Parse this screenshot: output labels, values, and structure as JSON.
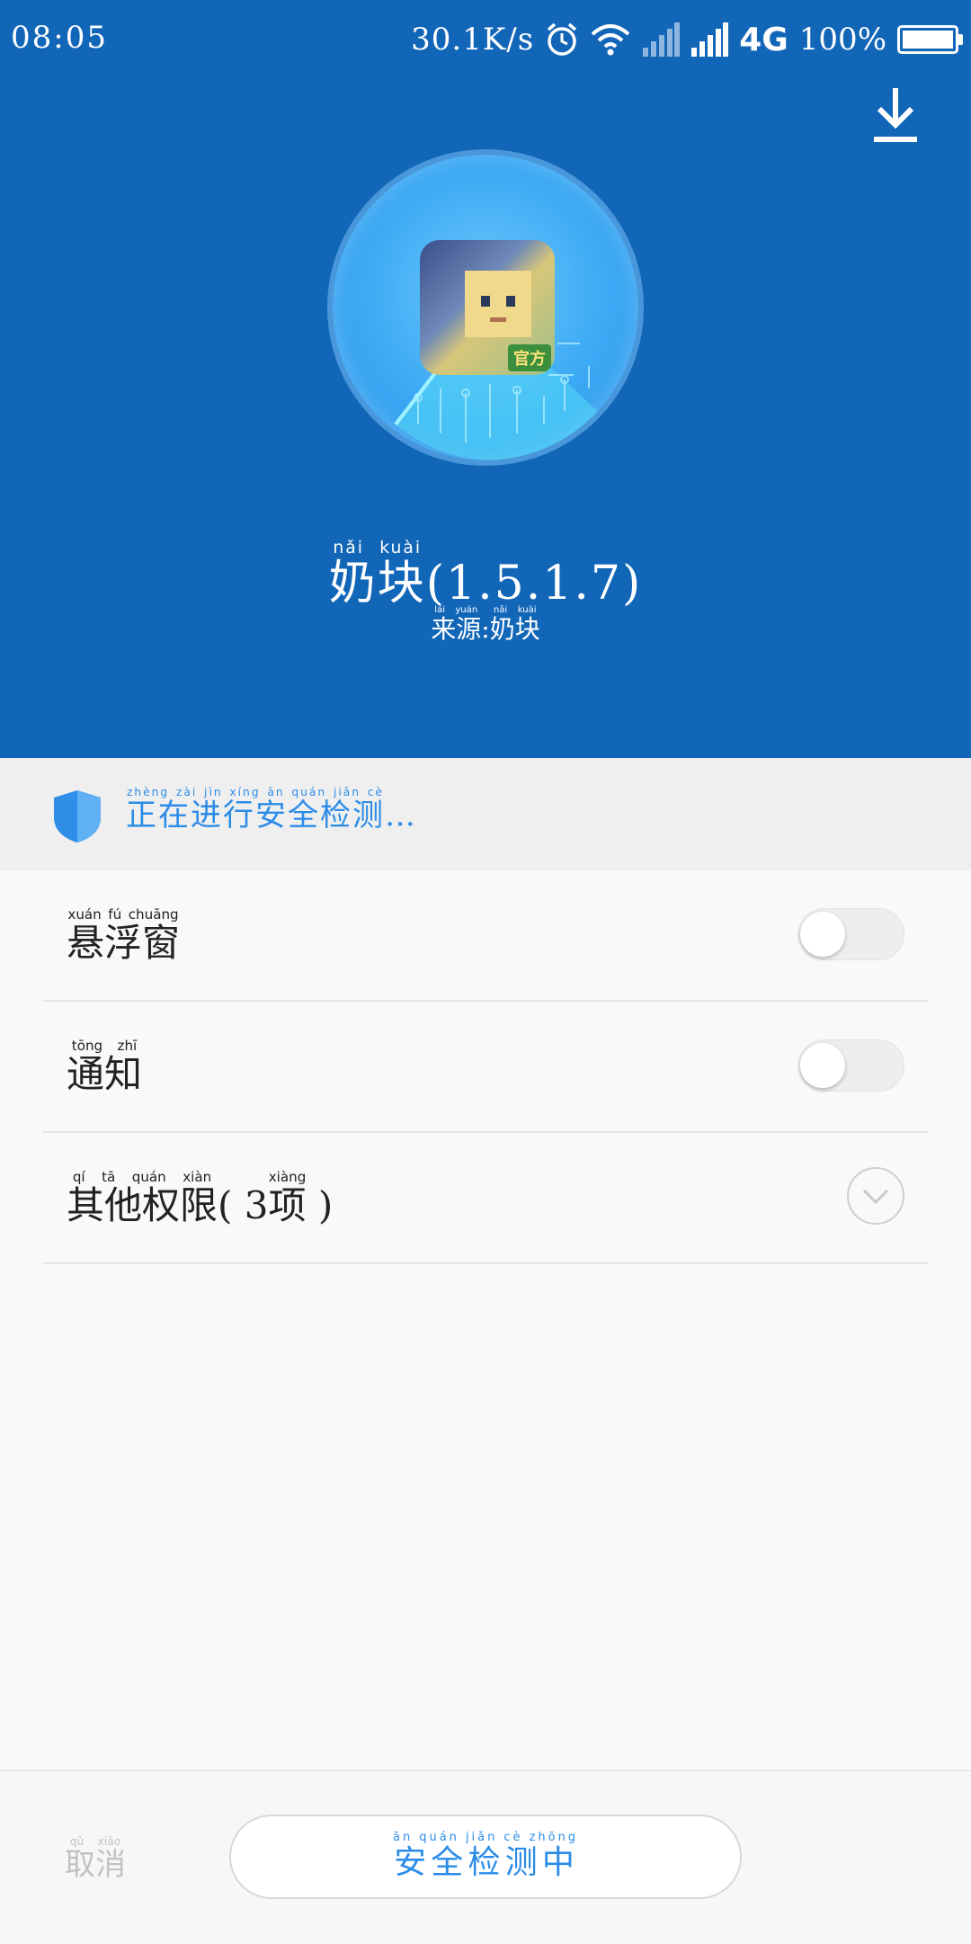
{
  "status_bar": {
    "time": "08:05",
    "net_speed": "30.1K/s",
    "network_type": "4G",
    "battery": "100%",
    "battery_level": 1.0,
    "icons": [
      "alarm-icon",
      "wifi-icon",
      "signal-icon",
      "signal-icon",
      "battery-icon"
    ]
  },
  "header": {
    "background_color": "#1166b8",
    "download_icon": "download-icon",
    "app_icon": "app-icon",
    "app_icon_badge": "官方",
    "app": {
      "name": "奶块",
      "name_pinyin": [
        "nǎi",
        "kuài"
      ],
      "version": "(1.5.1.7)",
      "source_label": "来源",
      "source_label_pinyin": [
        "lái",
        "yuán"
      ],
      "source_separator": ":",
      "source_value": "奶块",
      "source_value_pinyin": [
        "nǎi",
        "kuài"
      ]
    }
  },
  "scan_status": {
    "icon": "shield-icon",
    "text": "正在进行安全检测",
    "text_pinyin": [
      "zhèng",
      "zài",
      "jìn",
      "xíng",
      "ān",
      "quán",
      "jiǎn",
      "cè"
    ],
    "ellipsis": "…",
    "color": "#2b8ce8"
  },
  "permissions": [
    {
      "label": "悬浮窗",
      "pinyin": [
        "xuán",
        "fú",
        "chuāng"
      ],
      "control": "toggle",
      "enabled": false
    },
    {
      "label": "通知",
      "pinyin": [
        "tōng",
        "zhī"
      ],
      "control": "toggle",
      "enabled": false
    },
    {
      "label_prefix": "其他权限",
      "pinyin": [
        "qí",
        "tā",
        "quán",
        "xiàn"
      ],
      "open_paren": "(",
      "count": "3",
      "unit": "项",
      "unit_pinyin": "xiàng",
      "close_paren": ")",
      "control": "expand",
      "expand_icon": "chevron-down-icon"
    }
  ],
  "footer": {
    "cancel": "取消",
    "cancel_pinyin": [
      "qǔ",
      "xiāo"
    ],
    "primary": "安全检测中",
    "primary_pinyin": [
      "ān",
      "quán",
      "jiǎn",
      "cè",
      "zhōng"
    ],
    "primary_color": "#2b8ce8"
  }
}
